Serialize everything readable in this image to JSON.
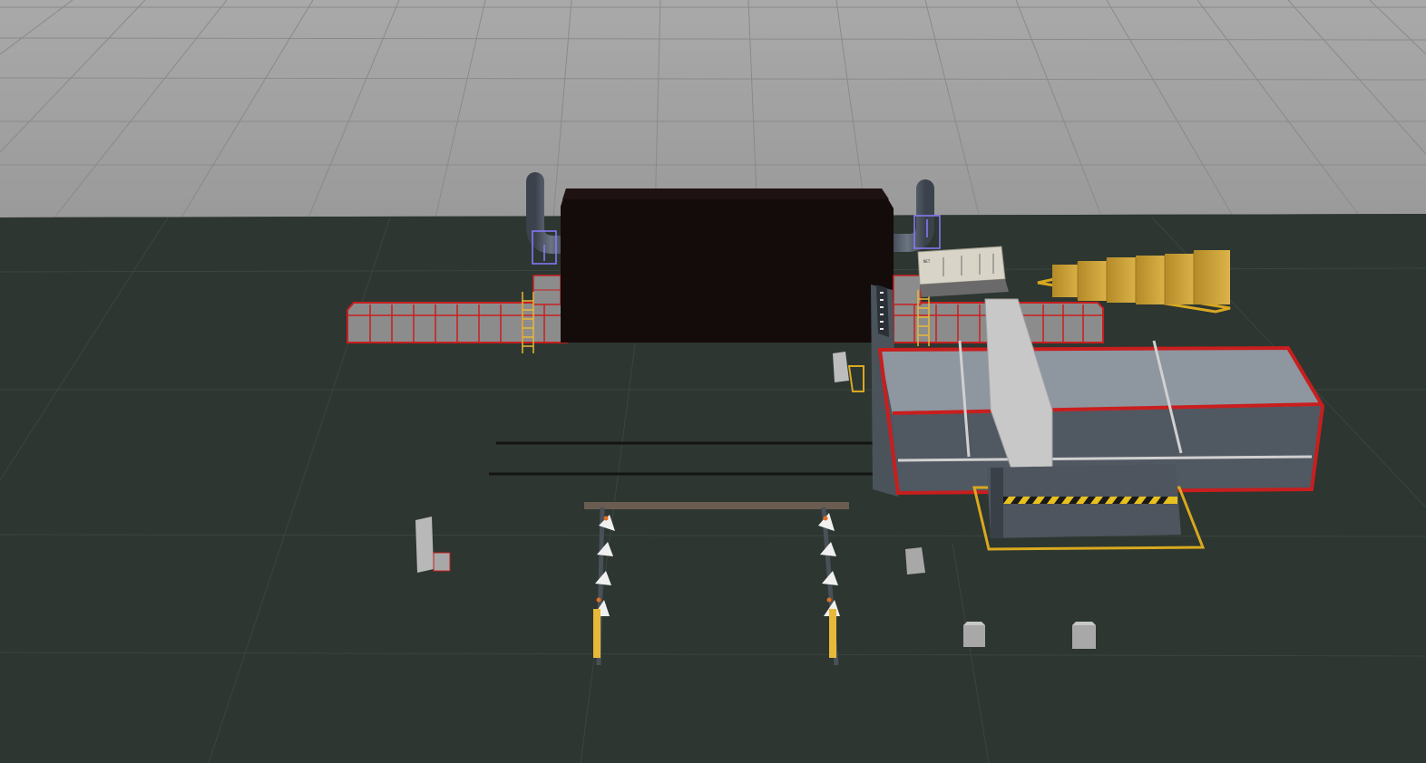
{
  "scene": {
    "colors": {
      "sky_wall": "#a6a6a6",
      "floor": "#2d3630",
      "frame_red": "#c81e1e",
      "panel_gray": "#8e8e8e",
      "oven_dark": "#140b0b",
      "duct_blue": "#505a66",
      "ladder_yellow": "#e8b838",
      "box_gold": "#c9a23a",
      "line_gray": "#5c626a",
      "marker_purple": "#8a7bff"
    },
    "icons": {
      "panel_marker": "tag-icon",
      "gizmo": "transform-gizmo-icon"
    },
    "control_panel": {
      "label": "NET"
    }
  }
}
